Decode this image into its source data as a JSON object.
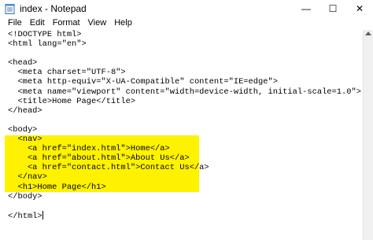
{
  "window": {
    "title": "index - Notepad",
    "icon": "notepad-icon",
    "controls": {
      "minimize": "—",
      "maximize": "☐",
      "close": "✕"
    }
  },
  "menu": {
    "items": [
      {
        "label": "File"
      },
      {
        "label": "Edit"
      },
      {
        "label": "Format"
      },
      {
        "label": "View"
      },
      {
        "label": "Help"
      }
    ]
  },
  "editor": {
    "highlight_color": "#fff200",
    "lines": [
      "<!DOCTYPE html>",
      "<html lang=\"en\">",
      "",
      "<head>",
      "  <meta charset=\"UTF-8\">",
      "  <meta http-equiv=\"X-UA-Compatible\" content=\"IE=edge\">",
      "  <meta name=\"viewport\" content=\"width=device-width, initial-scale=1.0\">",
      "  <title>Home Page</title>",
      "</head>",
      "",
      "<body>",
      "  <nav>",
      "    <a href=\"index.html\">Home</a>",
      "    <a href=\"about.html\">About Us</a>",
      "    <a href=\"contact.html\">Contact Us</a>",
      "  </nav>",
      "  <h1>Home Page</h1>",
      "</body>",
      "",
      "</html>"
    ]
  }
}
